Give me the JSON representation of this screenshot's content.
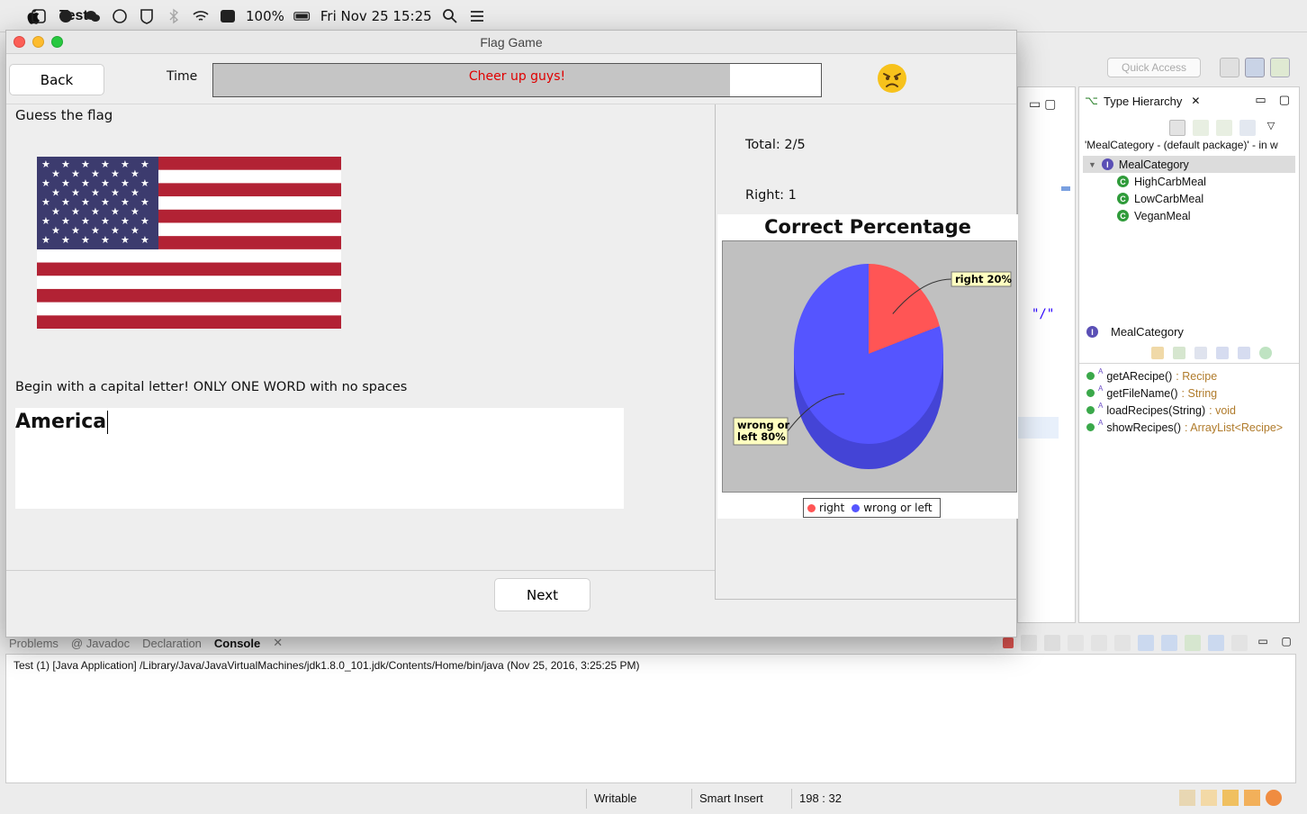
{
  "menubar": {
    "app_name": "Test",
    "battery": "100%",
    "datetime": "Fri Nov 25  15:25"
  },
  "eclipse": {
    "quick_access_placeholder": "Quick Access",
    "editor_text": "\"/\"",
    "type_hierarchy": {
      "tab_label": "Type Hierarchy",
      "path": "'MealCategory - (default package)' - in w",
      "root": "MealCategory",
      "children": [
        "HighCarbMeal",
        "LowCarbMeal",
        "VeganMeal"
      ],
      "member_title": "MealCategory",
      "members": [
        {
          "name": "getARecipe()",
          "ret": " : Recipe"
        },
        {
          "name": "getFileName()",
          "ret": " : String"
        },
        {
          "name": "loadRecipes(String)",
          "ret": " : void"
        },
        {
          "name": "showRecipes()",
          "ret": " : ArrayList<Recipe>"
        }
      ]
    },
    "console": {
      "tabs": [
        "Problems",
        "@ Javadoc",
        "Declaration",
        "Console"
      ],
      "line": "Test (1) [Java Application] /Library/Java/JavaVirtualMachines/jdk1.8.0_101.jdk/Contents/Home/bin/java (Nov 25, 2016, 3:25:25 PM)"
    },
    "status": {
      "writable": "Writable",
      "insert_mode": "Smart Insert",
      "position": "198 : 32"
    }
  },
  "game": {
    "window_title": "Flag Game",
    "back_label": "Back",
    "time_label": "Time",
    "progress_text": "Cheer up guys!",
    "progress_fraction": 0.85,
    "guess_label": "Guess the flag",
    "hint": "Begin with a capital letter!   ONLY ONE WORD with no spaces",
    "answer_value": "America",
    "next_label": "Next",
    "total": "Total: 2/5",
    "right": "Right: 1",
    "colors": {
      "right": "#ff5555",
      "wrong": "#5555ff",
      "progress_text": "#e00000"
    }
  },
  "chart_data": {
    "type": "pie",
    "title": "Correct Percentage",
    "categories": [
      "right",
      "wrong or left"
    ],
    "values": [
      20,
      80
    ],
    "unit": "%",
    "labels": [
      "right 20%",
      "wrong or\nleft 80%"
    ],
    "legend": "bottom"
  }
}
